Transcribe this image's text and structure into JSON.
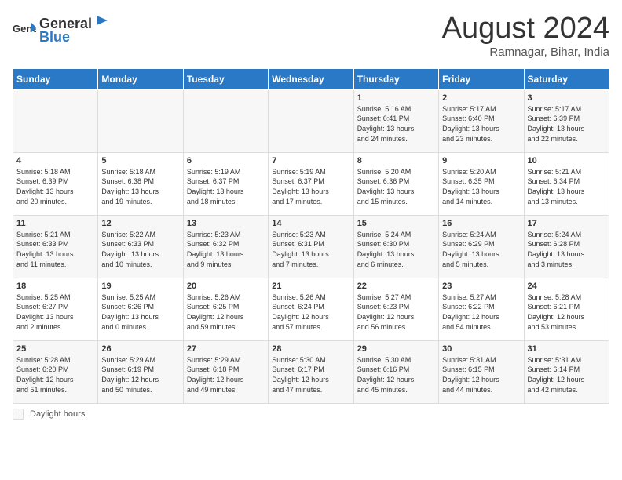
{
  "header": {
    "logo_general": "General",
    "logo_blue": "Blue",
    "title": "August 2024",
    "subtitle": "Ramnagar, Bihar, India"
  },
  "days_of_week": [
    "Sunday",
    "Monday",
    "Tuesday",
    "Wednesday",
    "Thursday",
    "Friday",
    "Saturday"
  ],
  "weeks": [
    [
      {
        "day": "",
        "text": ""
      },
      {
        "day": "",
        "text": ""
      },
      {
        "day": "",
        "text": ""
      },
      {
        "day": "",
        "text": ""
      },
      {
        "day": "1",
        "text": "Sunrise: 5:16 AM\nSunset: 6:41 PM\nDaylight: 13 hours\nand 24 minutes."
      },
      {
        "day": "2",
        "text": "Sunrise: 5:17 AM\nSunset: 6:40 PM\nDaylight: 13 hours\nand 23 minutes."
      },
      {
        "day": "3",
        "text": "Sunrise: 5:17 AM\nSunset: 6:39 PM\nDaylight: 13 hours\nand 22 minutes."
      }
    ],
    [
      {
        "day": "4",
        "text": "Sunrise: 5:18 AM\nSunset: 6:39 PM\nDaylight: 13 hours\nand 20 minutes."
      },
      {
        "day": "5",
        "text": "Sunrise: 5:18 AM\nSunset: 6:38 PM\nDaylight: 13 hours\nand 19 minutes."
      },
      {
        "day": "6",
        "text": "Sunrise: 5:19 AM\nSunset: 6:37 PM\nDaylight: 13 hours\nand 18 minutes."
      },
      {
        "day": "7",
        "text": "Sunrise: 5:19 AM\nSunset: 6:37 PM\nDaylight: 13 hours\nand 17 minutes."
      },
      {
        "day": "8",
        "text": "Sunrise: 5:20 AM\nSunset: 6:36 PM\nDaylight: 13 hours\nand 15 minutes."
      },
      {
        "day": "9",
        "text": "Sunrise: 5:20 AM\nSunset: 6:35 PM\nDaylight: 13 hours\nand 14 minutes."
      },
      {
        "day": "10",
        "text": "Sunrise: 5:21 AM\nSunset: 6:34 PM\nDaylight: 13 hours\nand 13 minutes."
      }
    ],
    [
      {
        "day": "11",
        "text": "Sunrise: 5:21 AM\nSunset: 6:33 PM\nDaylight: 13 hours\nand 11 minutes."
      },
      {
        "day": "12",
        "text": "Sunrise: 5:22 AM\nSunset: 6:33 PM\nDaylight: 13 hours\nand 10 minutes."
      },
      {
        "day": "13",
        "text": "Sunrise: 5:23 AM\nSunset: 6:32 PM\nDaylight: 13 hours\nand 9 minutes."
      },
      {
        "day": "14",
        "text": "Sunrise: 5:23 AM\nSunset: 6:31 PM\nDaylight: 13 hours\nand 7 minutes."
      },
      {
        "day": "15",
        "text": "Sunrise: 5:24 AM\nSunset: 6:30 PM\nDaylight: 13 hours\nand 6 minutes."
      },
      {
        "day": "16",
        "text": "Sunrise: 5:24 AM\nSunset: 6:29 PM\nDaylight: 13 hours\nand 5 minutes."
      },
      {
        "day": "17",
        "text": "Sunrise: 5:24 AM\nSunset: 6:28 PM\nDaylight: 13 hours\nand 3 minutes."
      }
    ],
    [
      {
        "day": "18",
        "text": "Sunrise: 5:25 AM\nSunset: 6:27 PM\nDaylight: 13 hours\nand 2 minutes."
      },
      {
        "day": "19",
        "text": "Sunrise: 5:25 AM\nSunset: 6:26 PM\nDaylight: 13 hours\nand 0 minutes."
      },
      {
        "day": "20",
        "text": "Sunrise: 5:26 AM\nSunset: 6:25 PM\nDaylight: 12 hours\nand 59 minutes."
      },
      {
        "day": "21",
        "text": "Sunrise: 5:26 AM\nSunset: 6:24 PM\nDaylight: 12 hours\nand 57 minutes."
      },
      {
        "day": "22",
        "text": "Sunrise: 5:27 AM\nSunset: 6:23 PM\nDaylight: 12 hours\nand 56 minutes."
      },
      {
        "day": "23",
        "text": "Sunrise: 5:27 AM\nSunset: 6:22 PM\nDaylight: 12 hours\nand 54 minutes."
      },
      {
        "day": "24",
        "text": "Sunrise: 5:28 AM\nSunset: 6:21 PM\nDaylight: 12 hours\nand 53 minutes."
      }
    ],
    [
      {
        "day": "25",
        "text": "Sunrise: 5:28 AM\nSunset: 6:20 PM\nDaylight: 12 hours\nand 51 minutes."
      },
      {
        "day": "26",
        "text": "Sunrise: 5:29 AM\nSunset: 6:19 PM\nDaylight: 12 hours\nand 50 minutes."
      },
      {
        "day": "27",
        "text": "Sunrise: 5:29 AM\nSunset: 6:18 PM\nDaylight: 12 hours\nand 49 minutes."
      },
      {
        "day": "28",
        "text": "Sunrise: 5:30 AM\nSunset: 6:17 PM\nDaylight: 12 hours\nand 47 minutes."
      },
      {
        "day": "29",
        "text": "Sunrise: 5:30 AM\nSunset: 6:16 PM\nDaylight: 12 hours\nand 45 minutes."
      },
      {
        "day": "30",
        "text": "Sunrise: 5:31 AM\nSunset: 6:15 PM\nDaylight: 12 hours\nand 44 minutes."
      },
      {
        "day": "31",
        "text": "Sunrise: 5:31 AM\nSunset: 6:14 PM\nDaylight: 12 hours\nand 42 minutes."
      }
    ]
  ],
  "footer": {
    "daylight_label": "Daylight hours"
  }
}
